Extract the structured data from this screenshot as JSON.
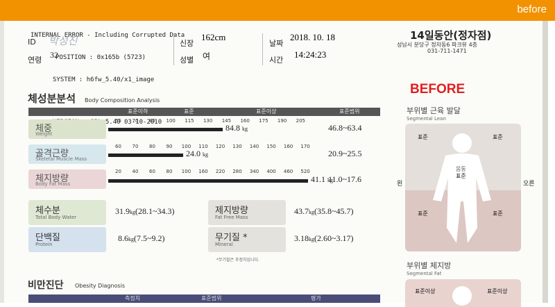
{
  "banner": {
    "label": "before"
  },
  "debug": {
    "line1": "INTERNAL ERROR - Including Corrupted Data",
    "line2": "POSITION : 0x165b (5723)",
    "system": "SYSTEM    : h6fw_5.40/x1_image",
    "version": "VERSION : SPL 5.40 03-10-2010"
  },
  "header": {
    "id_label": "ID",
    "id_handwritten": "박성진",
    "age_label": "연령",
    "age_value": "32",
    "height_label": "신장",
    "height_value": "162cm",
    "sex_label": "성별",
    "sex_value": "여",
    "date_label": "날짜",
    "date_value": "2018. 10. 18",
    "time_label": "시간",
    "time_value": "14:24:23",
    "clinic_name": "14일동안(정자점)",
    "clinic_address": "성남시 분당구 정자동6 파크뷰 4층",
    "clinic_phone": "031-711-1471"
  },
  "before_stamp": "BEFORE",
  "composition": {
    "title": "체성분분석",
    "subtitle": "Body Composition Analysis",
    "col_under": "표준이하",
    "col_standard": "표준",
    "col_over": "표준이상",
    "col_range": "표준범위",
    "rows": [
      {
        "label": "체중",
        "en": "Weight",
        "scale": [
          "55",
          "70",
          "85",
          "100",
          "115",
          "130",
          "145",
          "160",
          "175",
          "190",
          "205"
        ],
        "value": "84.8",
        "unit": "kg",
        "level": 0.55,
        "range": "46.8~63.4"
      },
      {
        "label": "골격근량",
        "en": "Skeletal Muscle Mass",
        "scale": [
          "60",
          "70",
          "80",
          "90",
          "100",
          "110",
          "120",
          "130",
          "140",
          "150",
          "160",
          "170"
        ],
        "value": "24.0",
        "unit": "kg",
        "level": 0.36,
        "range": "20.9~25.5"
      },
      {
        "label": "체지방량",
        "en": "Body Fat Mass",
        "scale": [
          "20",
          "40",
          "60",
          "80",
          "100",
          "160",
          "220",
          "280",
          "340",
          "400",
          "460",
          "520"
        ],
        "value": "41.1",
        "unit": "kg",
        "level": 0.96,
        "range": "11.0~17.6"
      }
    ]
  },
  "metrics": [
    {
      "label": "체수분",
      "en": "Total Body Water",
      "value": "31.9",
      "unit": "kg",
      "range": "(28.1~34.3)"
    },
    {
      "label": "단백질",
      "en": "Protein",
      "value": "8.6",
      "unit": "kg",
      "range": "(7.5~9.2)"
    },
    {
      "label": "제지방량",
      "en": "Fat Free Mass",
      "value": "43.7",
      "unit": "kg",
      "range": "(35.8~45.7)"
    },
    {
      "label": "무기질 *",
      "en": "Mineral",
      "value": "3.18",
      "unit": "kg",
      "range": "(2.60~3.17)"
    }
  ],
  "footnote": "*무기질은 추정치입니다.",
  "segment_lean": {
    "title": "부위별 근육 발달",
    "en": "Segmental Lean",
    "left_arm": "표준",
    "right_arm": "표준",
    "trunk_top": "몸통",
    "trunk": "표준",
    "left_leg": "표준",
    "right_leg": "표준",
    "side_left": "왼",
    "side_right": "오른"
  },
  "segment_fat": {
    "title": "부위별 체지방",
    "en": "Segmental Fat",
    "left_arm": "표준이상",
    "right_arm": "표준이상"
  },
  "obesity": {
    "title": "비만진단",
    "en": "Obesity Diagnosis",
    "col1": "측정치",
    "col2": "표준범위",
    "col3": "평가"
  }
}
